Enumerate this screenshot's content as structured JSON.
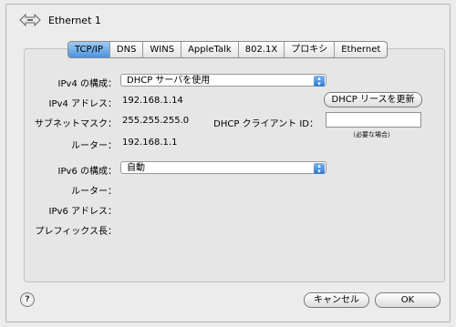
{
  "window": {
    "title": "Ethernet 1"
  },
  "tabs": [
    {
      "label": "TCP/IP",
      "active": true
    },
    {
      "label": "DNS"
    },
    {
      "label": "WINS"
    },
    {
      "label": "AppleTalk"
    },
    {
      "label": "802.1X"
    },
    {
      "label": "プロキシ"
    },
    {
      "label": "Ethernet"
    }
  ],
  "ipv4": {
    "config_label": "IPv4 の構成：",
    "config_value": "DHCP サーバを使用",
    "address_label": "IPv4 アドレス：",
    "address_value": "192.168.1.14",
    "renew_button": "DHCP リースを更新",
    "subnet_label": "サブネットマスク：",
    "subnet_value": "255.255.255.0",
    "client_id_label": "DHCP クライアント ID：",
    "client_id_value": "",
    "client_id_hint": "（必要な場合）",
    "router_label": "ルーター：",
    "router_value": "192.168.1.1"
  },
  "ipv6": {
    "config_label": "IPv6 の構成：",
    "config_value": "自動",
    "router_label": "ルーター：",
    "address_label": "IPv6 アドレス：",
    "prefix_label": "プレフィックス長："
  },
  "footer": {
    "help_glyph": "?",
    "cancel_button": "キャンセル",
    "ok_button": "OK"
  },
  "icons": {
    "window": "ethernet-icon",
    "help": "help-icon",
    "popup": "popup-arrows-icon"
  }
}
